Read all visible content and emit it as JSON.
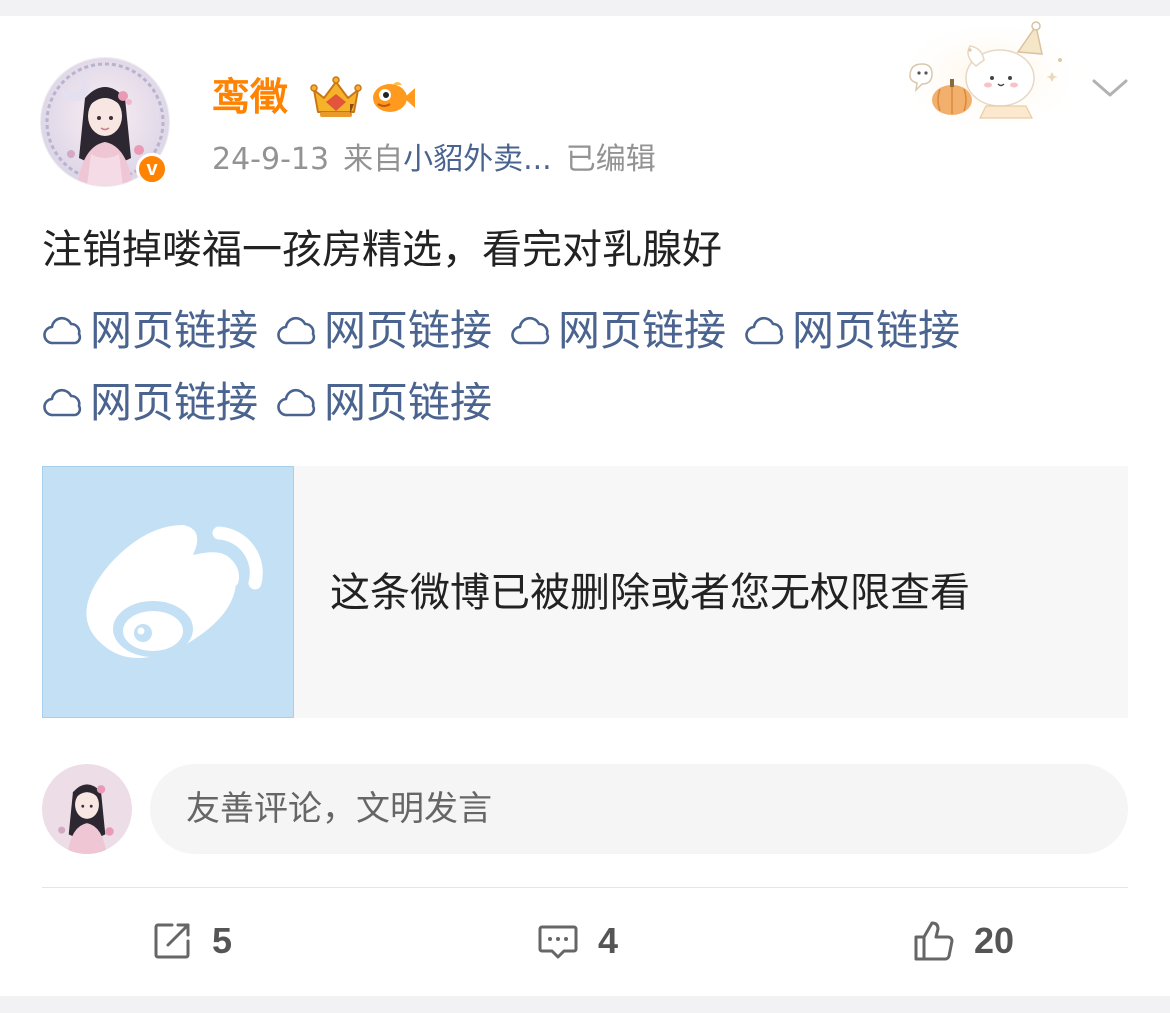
{
  "post": {
    "username": "鸾徵",
    "date": "24-9-13",
    "source_prefix": "来自",
    "source_app": "小貂外卖...",
    "edited_label": "已编辑",
    "verified_mark": "v",
    "text": "注销掉喽福一孩房精选，看完对乳腺好",
    "links": [
      {
        "label": "网页链接"
      },
      {
        "label": "网页链接"
      },
      {
        "label": "网页链接"
      },
      {
        "label": "网页链接"
      },
      {
        "label": "网页链接"
      },
      {
        "label": "网页链接"
      }
    ],
    "deleted_message": "这条微博已被删除或者您无权限查看"
  },
  "comment_box": {
    "placeholder": "友善评论，文明发言"
  },
  "actions": {
    "repost_count": "5",
    "comment_count": "4",
    "like_count": "20"
  },
  "colors": {
    "username": "#ff8200",
    "link": "#4a638f",
    "meta": "#939393",
    "deleted_thumb_bg": "#c3e0f5"
  }
}
